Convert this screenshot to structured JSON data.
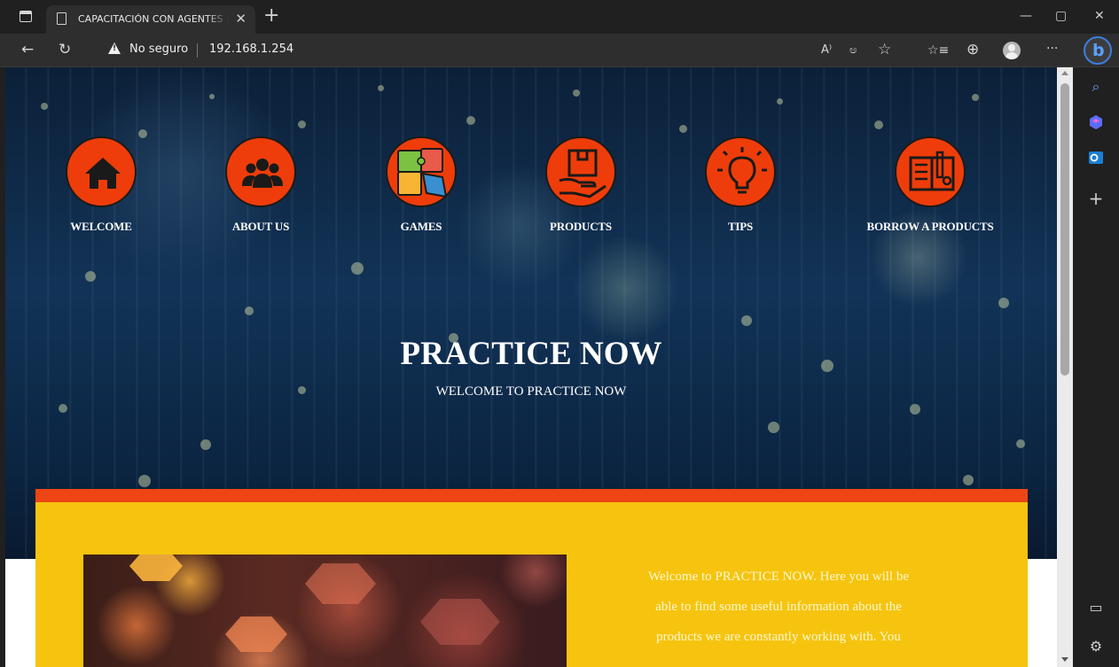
{
  "browser": {
    "tab": {
      "title": "CAPACITACIÓN CON AGENTES D",
      "close": "✕"
    },
    "new_tab": "+",
    "window_controls": {
      "minimize": "—",
      "maximize": "▢",
      "close": "✕"
    },
    "address": {
      "security_label": "No seguro",
      "url": "192.168.1.254"
    },
    "toolbar_icons": [
      "back-icon",
      "refresh-icon",
      "read-aloud-icon",
      "translate-icon",
      "favorite-add-icon",
      "favorites-icon",
      "collections-icon",
      "profile-avatar",
      "more-icon",
      "bing-chat-icon"
    ],
    "toolbar_glyphs": {
      "back": "←",
      "refresh": "↻",
      "read_aloud": "A⁾",
      "translate": "ಅ",
      "favorite_add": "☆",
      "favorites": "☆≡",
      "collections": "⊕",
      "more": "···",
      "bing": "b"
    },
    "sidebar_glyphs": {
      "search": "⌕",
      "add": "+",
      "panel": "▭",
      "settings": "⚙"
    },
    "sidebar_icons": [
      "search-icon",
      "copilot-icon",
      "outlook-icon",
      "add-icon",
      "toggle-panel-icon",
      "settings-icon"
    ],
    "accent": "#3d7fe0"
  },
  "site": {
    "nav": [
      {
        "label": "WELCOME",
        "icon": "home-icon"
      },
      {
        "label": "ABOUT US",
        "icon": "group-icon"
      },
      {
        "label": "GAMES",
        "icon": "puzzle-icon"
      },
      {
        "label": "PRODUCTS",
        "icon": "product-box-icon"
      },
      {
        "label": "TIPS",
        "icon": "lightbulb-icon"
      },
      {
        "label": "BORROW A PRODUCTS",
        "icon": "tools-manual-icon"
      }
    ],
    "hero": {
      "title": "PRACTICE NOW",
      "subtitle": "WELCOME TO PRACTICE NOW"
    },
    "intro": {
      "line1": "Welcome to PRACTICE NOW. Here you will be",
      "line2": "able to find some useful information about the",
      "line3": "products we are constantly working with. You"
    },
    "colors": {
      "nav_circle": "#ee3d0a",
      "card_background": "#f6c40f",
      "card_top_bar": "#ee4515"
    }
  }
}
